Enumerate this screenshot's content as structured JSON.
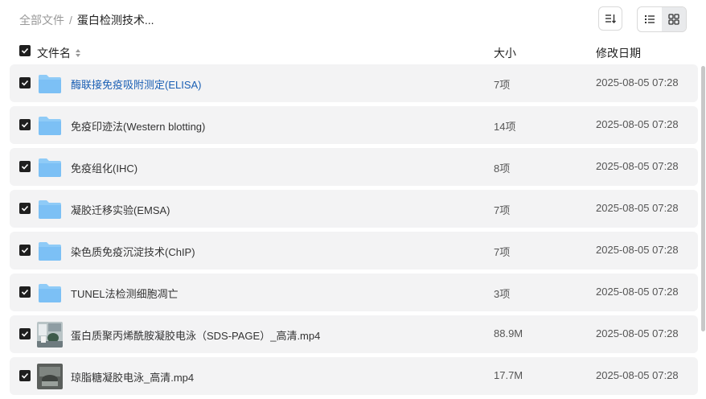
{
  "breadcrumb": {
    "root": "全部文件",
    "separator": "/",
    "current": "蛋白检测技术..."
  },
  "columns": {
    "name": "文件名",
    "size": "大小",
    "modified": "修改日期"
  },
  "rows": [
    {
      "name": "酶联接免疫吸附测定(ELISA)",
      "size": "7项",
      "date": "2025-08-05 07:28",
      "type": "folder"
    },
    {
      "name": "免疫印迹法(Western blotting)",
      "size": "14项",
      "date": "2025-08-05 07:28",
      "type": "folder"
    },
    {
      "name": "免疫组化(IHC)",
      "size": "8项",
      "date": "2025-08-05 07:28",
      "type": "folder"
    },
    {
      "name": "凝胶迁移实验(EMSA)",
      "size": "7项",
      "date": "2025-08-05 07:28",
      "type": "folder"
    },
    {
      "name": "染色质免疫沉淀技术(ChIP)",
      "size": "7项",
      "date": "2025-08-05 07:28",
      "type": "folder"
    },
    {
      "name": "TUNEL法检测细胞凋亡",
      "size": "3项",
      "date": "2025-08-05 07:28",
      "type": "folder"
    },
    {
      "name": "蛋白质聚丙烯酰胺凝胶电泳（SDS-PAGE）_高清.mp4",
      "size": "88.9M",
      "date": "2025-08-05 07:28",
      "type": "video"
    },
    {
      "name": "琼脂糖凝胶电泳_高清.mp4",
      "size": "17.7M",
      "date": "2025-08-05 07:28",
      "type": "video"
    }
  ],
  "colors": {
    "folder": "#7cc0f5",
    "link": "#1a5fb4",
    "row_bg": "#f3f3f4",
    "checkbox": "#1f1f1f"
  }
}
